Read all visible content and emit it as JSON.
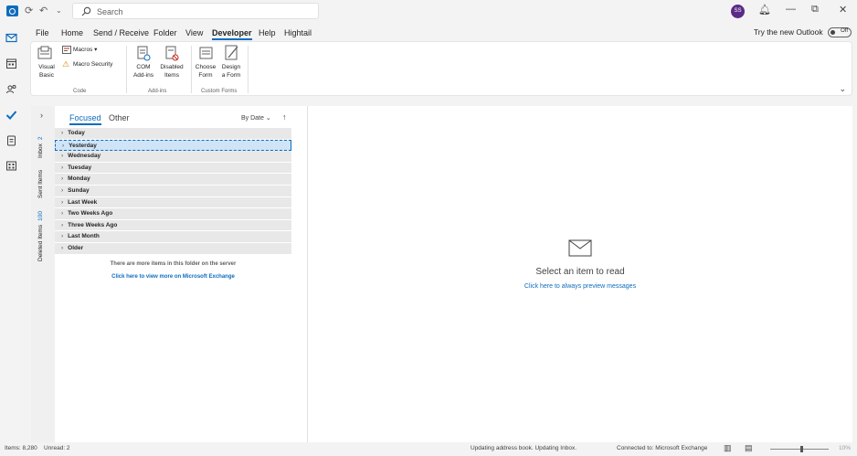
{
  "titlebar": {
    "search_placeholder": "Search",
    "avatar_initials": "SS"
  },
  "menu": {
    "items": [
      "File",
      "Home",
      "Send / Receive",
      "Folder",
      "View",
      "Developer",
      "Help",
      "Hightail"
    ],
    "active": "Developer",
    "try_new": "Try the new Outlook",
    "toggle_state": "Off"
  },
  "ribbon": {
    "visual_basic": "Visual\nBasic",
    "macros": "Macros",
    "macro_security": "Macro Security",
    "com_addins": "COM\nAdd-ins",
    "disabled_items": "Disabled\nItems",
    "choose_form": "Choose\nForm",
    "design_form": "Design\na Form",
    "group_code": "Code",
    "group_addins": "Add-ins",
    "group_custom_forms": "Custom Forms"
  },
  "folders": {
    "inbox": "Inbox",
    "inbox_count": "2",
    "sent": "Sent Items",
    "deleted": "Deleted Items",
    "deleted_count": "100"
  },
  "msglist": {
    "tab_focused": "Focused",
    "tab_other": "Other",
    "sort": "By Date",
    "groups": [
      "Today",
      "Yesterday",
      "Wednesday",
      "Tuesday",
      "Monday",
      "Sunday",
      "Last Week",
      "Two Weeks Ago",
      "Three Weeks Ago",
      "Last Month",
      "Older"
    ],
    "selected_group": "Yesterday",
    "more_items": "There are more items in this folder on the server",
    "more_link": "Click here to view more on Microsoft Exchange"
  },
  "reading": {
    "title": "Select an item to read",
    "link": "Click here to always preview messages"
  },
  "status": {
    "items": "Items: 8,280",
    "unread": "Unread: 2",
    "updating": "Updating address book.  Updating Inbox.",
    "connected": "Connected to: Microsoft Exchange",
    "zoom": "10%"
  },
  "colors": {
    "accent": "#0f6cbd",
    "selected_row": "#cfe4f7",
    "group_bg": "#e8e8e8"
  }
}
